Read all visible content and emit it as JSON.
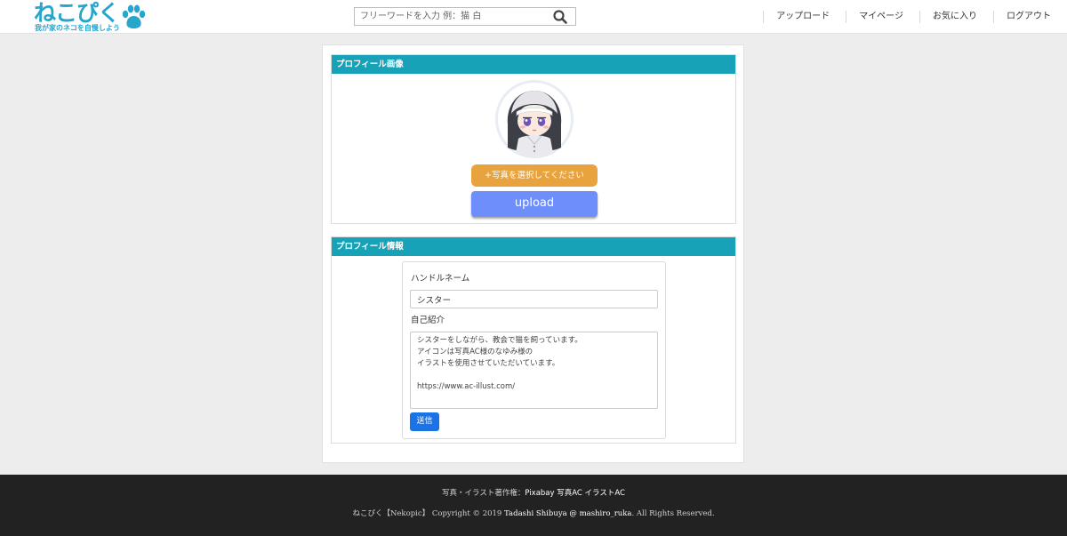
{
  "header": {
    "logo_text": "ねこぴく",
    "logo_tagline": "我が家のネコを自慢しよう",
    "search": {
      "placeholder": "フリーワードを入力 例：猫 白"
    },
    "nav": [
      {
        "label": "アップロード"
      },
      {
        "label": "マイページ"
      },
      {
        "label": "お気に入り"
      },
      {
        "label": "ログアウト"
      }
    ]
  },
  "profile_image": {
    "title": "プロフィール画像",
    "select_button": "+写真を選択してください",
    "upload_button": "upload"
  },
  "profile_info": {
    "title": "プロフィール情報",
    "handle_label": "ハンドルネーム",
    "handle_value": "シスター",
    "bio_label": "自己紹介",
    "bio_value": "シスターをしながら、教会で猫を飼っています。\nアイコンは写真AC様のなゆみ様の\nイラストを使用させていただいています。\n\nhttps://www.ac-illust.com/",
    "submit_button": "送信"
  },
  "footer": {
    "credit_prefix": "写真・イラスト著作権：",
    "credit_sites": "Pixabay 写真AC イラストAC",
    "copyright_prefix": "ねこぴく【Nekopic】 Copyright © 2019 ",
    "copyright_author": "Tadashi Shibuya @ mashiro_ruka",
    "copyright_suffix": ". All Rights Reserved."
  },
  "colors": {
    "brand": "#27a6cd",
    "panel_header": "#17a2b8",
    "select_button": "#e8a33e",
    "upload_button": "#6e8efb",
    "submit_button": "#1b73e8",
    "footer_bg": "#222222"
  }
}
